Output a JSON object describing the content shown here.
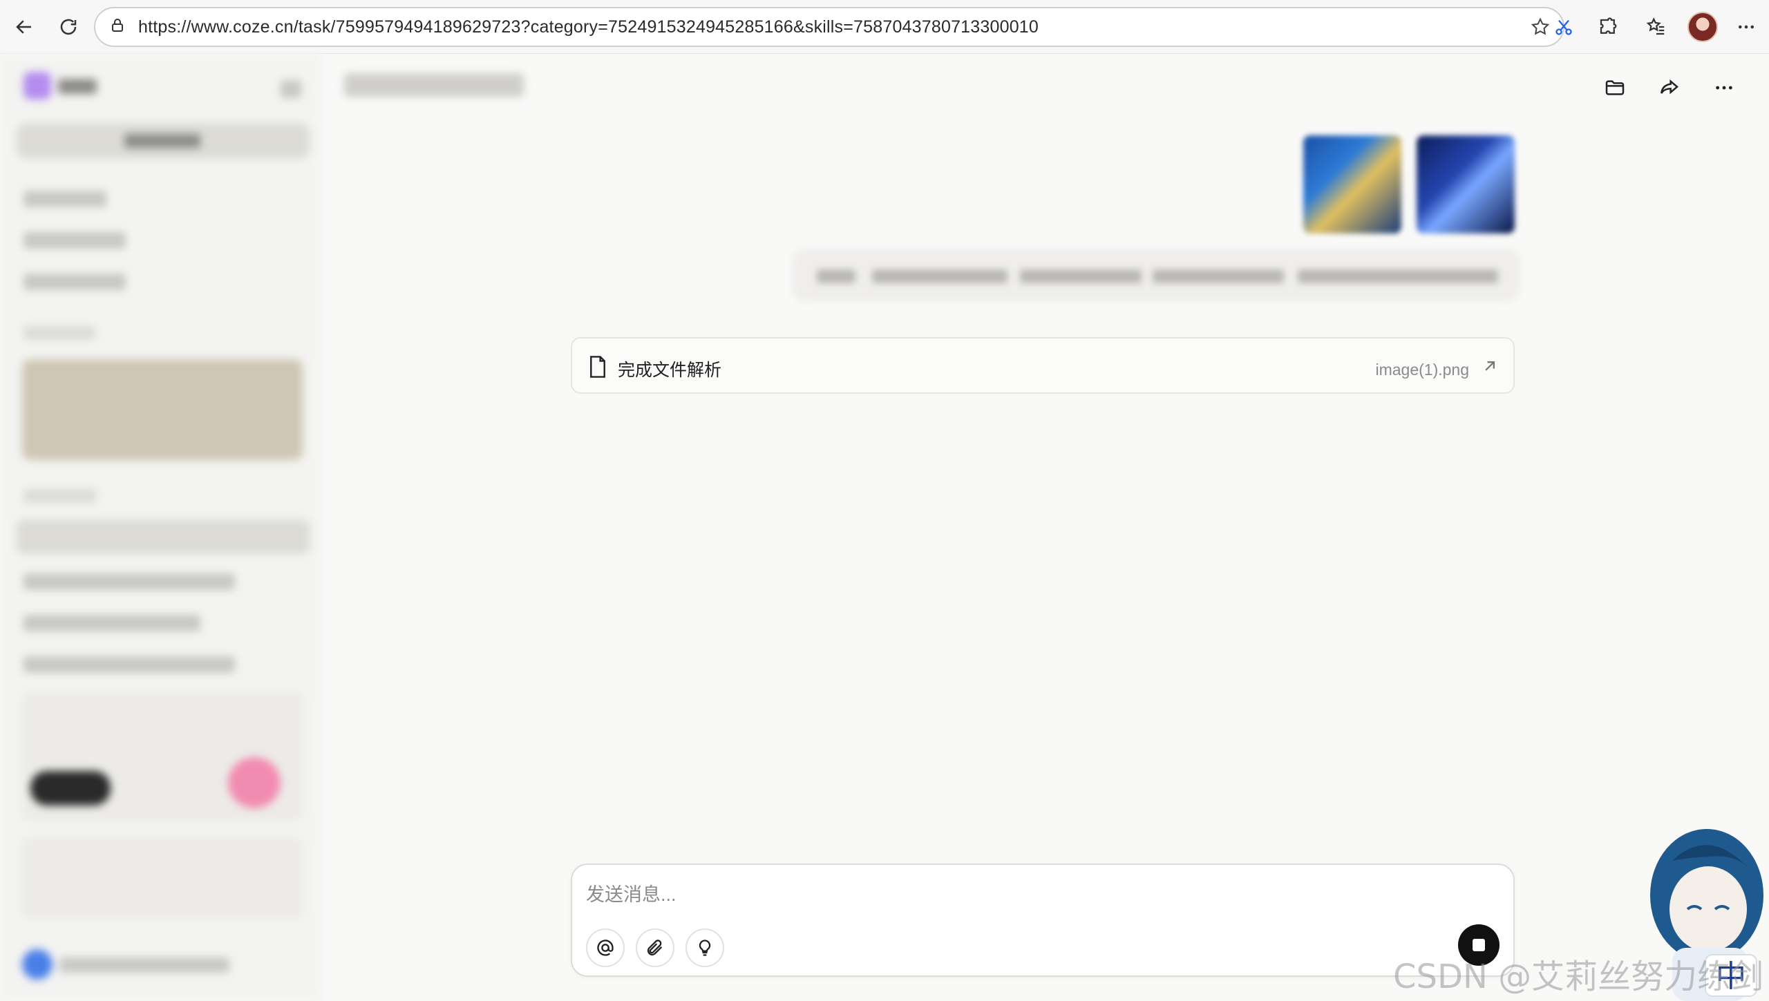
{
  "browser": {
    "url": "https://www.coze.cn/task/7599579494189629723?category=7524915324945285166&skills=7587043780713300010"
  },
  "file_card": {
    "title": "完成文件解析",
    "file_name": "image(1).png"
  },
  "composer": {
    "placeholder": "发送消息..."
  },
  "overlay": {
    "watermark": "CSDN @艾莉丝努力练剑",
    "mascot_badge": "中"
  },
  "colors": {
    "background": "#f9f9f8",
    "stop_button": "#111111",
    "mascot_blue": "#1f5a8e"
  }
}
